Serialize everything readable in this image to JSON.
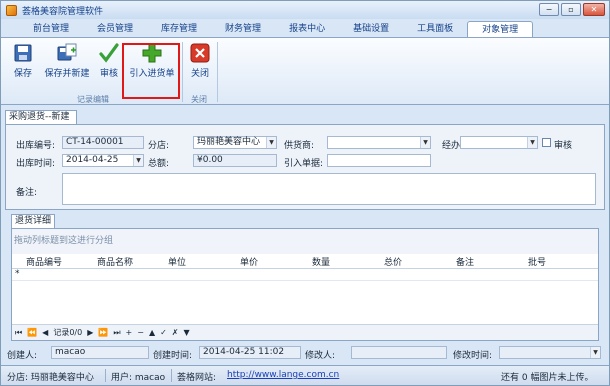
{
  "window": {
    "title": "荟格美容院管理软件",
    "minimize": "−",
    "restore": "▫",
    "close": "✕"
  },
  "tabs": [
    "前台管理",
    "会员管理",
    "库存管理",
    "财务管理",
    "报表中心",
    "基础设置",
    "工具面板",
    "对象管理"
  ],
  "active_tab": "对象管理",
  "ribbon": {
    "save": "保存",
    "save_new": "保存并新建",
    "audit": "审核",
    "import": "引入进货单",
    "close": "关闭",
    "group_record": "记录编辑",
    "group_close": "关闭"
  },
  "doc_tab": "采购退货--新建",
  "form": {
    "doc_no_label": "出库编号:",
    "doc_no": "CT-14-00001",
    "branch_label": "分店:",
    "branch": "玛丽艳美容中心",
    "supplier_label": "供货商:",
    "supplier": "",
    "handler_label": "经办人:",
    "handler": "",
    "audit_label": "审核",
    "date_label": "出库时间:",
    "date": "2014-04-25",
    "total_label": "总额:",
    "total": "¥0.00",
    "import_no_label": "引入单据:",
    "import_no": "",
    "remark_label": "备注:",
    "remark": ""
  },
  "detail_tab": "退货详细",
  "grid": {
    "group_hint": "拖动列标题到这进行分组",
    "columns": [
      "商品编号",
      "商品名称",
      "单位",
      "单价",
      "数量",
      "总价",
      "备注",
      "批号"
    ],
    "new_row_marker": "*",
    "nav_text": "记录0/0"
  },
  "audit_bar": {
    "creator_label": "创建人:",
    "creator": "macao",
    "created_label": "创建时间:",
    "created": "2014-04-25  11:02",
    "modifier_label": "修改人:",
    "modifier": "",
    "modified_label": "修改时间:",
    "modified": ""
  },
  "status": {
    "branch": "分店: 玛丽艳美容中心",
    "user": "用户: macao",
    "site_label": "荟格网站:",
    "site_url": "http://www.lange.com.cn",
    "upload": "还有 0 幅图片未上传。"
  },
  "colors": {
    "accent": "#15428b",
    "highlight_box": "#e01818",
    "link": "#1a3fb8"
  }
}
